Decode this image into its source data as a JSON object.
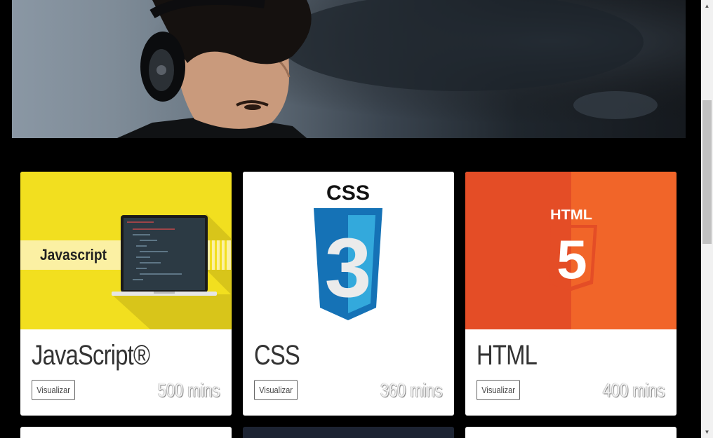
{
  "hero": {
    "alt": "person-with-headphones"
  },
  "courses": [
    {
      "title": "JavaScript®",
      "button_label": "Visualizar",
      "duration": "500 mins",
      "thumb_label": "Javascript"
    },
    {
      "title": "CSS",
      "button_label": "Visualizar",
      "duration": "360 mins",
      "thumb_label": "CSS",
      "thumb_number": "3"
    },
    {
      "title": "HTML",
      "button_label": "Visualizar",
      "duration": "400 mins",
      "thumb_label": "HTML",
      "thumb_number": "5"
    }
  ],
  "colors": {
    "background": "#000000",
    "js_yellow": "#f2df1f",
    "css_blue": "#1572b6",
    "html_orange": "#e44d26",
    "card_bg": "#ffffff"
  }
}
